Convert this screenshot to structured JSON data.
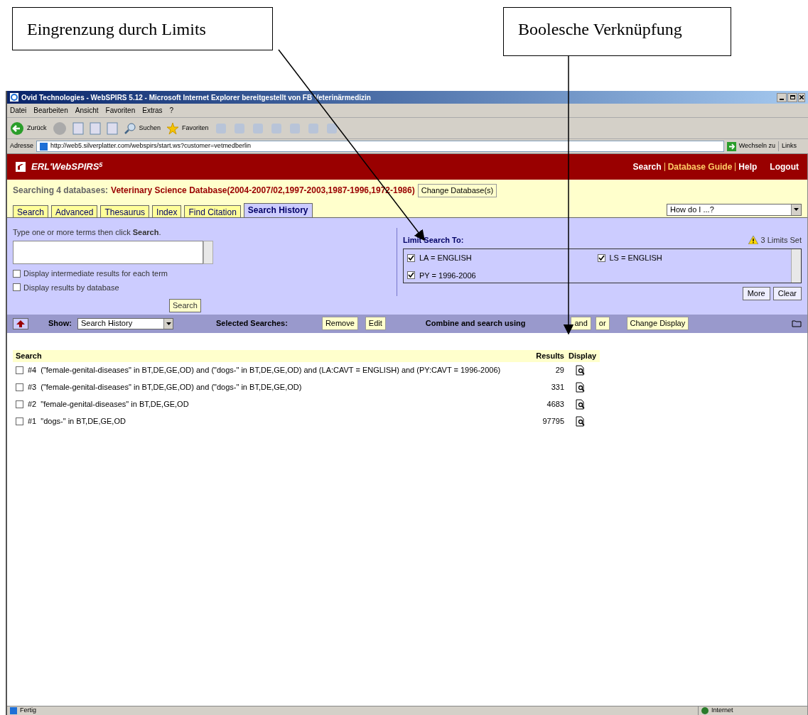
{
  "annotations": [
    {
      "text": "Eingrenzung durch Limits"
    },
    {
      "text": "Boolesche Verknüpfung"
    }
  ],
  "window": {
    "title": "Ovid Technologies - WebSPIRS 5.12 - Microsoft Internet Explorer bereitgestellt von FB Veterinärmedizin"
  },
  "menu": [
    "Datei",
    "Bearbeiten",
    "Ansicht",
    "Favoriten",
    "Extras",
    "?"
  ],
  "toolbar": {
    "back": "Zurück",
    "search": "Suchen",
    "favorites": "Favoriten"
  },
  "address_bar": {
    "label": "Adresse",
    "url": "http://web5.silverplatter.com/webspirs/start.ws?customer=vetmedberlin",
    "go": "Wechseln zu",
    "links": "Links"
  },
  "header": {
    "logo": "ERL'WebSPIRS",
    "logo_version": "5",
    "nav": [
      {
        "label": "Search",
        "selected": true
      },
      {
        "label": "Database Guide",
        "selected": false
      },
      {
        "label": "Help",
        "selected": true
      },
      {
        "label": "Logout",
        "selected": true
      }
    ]
  },
  "databases": {
    "label": "Searching 4 databases:",
    "value": "Veterinary Science Database(2004-2007/02,1997-2003,1987-1996,1972-1986)",
    "button": "Change Database(s)"
  },
  "tabs": [
    {
      "label": "Search",
      "selected": false
    },
    {
      "label": "Advanced",
      "selected": false
    },
    {
      "label": "Thesaurus",
      "selected": false
    },
    {
      "label": "Index",
      "selected": false
    },
    {
      "label": "Find Citation",
      "selected": false
    },
    {
      "label": "Search History",
      "selected": true
    }
  ],
  "help_select": {
    "value": "How do I ...?"
  },
  "search_panel": {
    "prompt": "Type one or more terms then click **Search**.",
    "options": [
      {
        "label": "Display intermediate results for each term",
        "checked": false
      },
      {
        "label": "Display results by database",
        "checked": false
      }
    ],
    "button": "Search"
  },
  "limits": {
    "title": "Limit Search To:",
    "count": "3 Limits Set",
    "items": [
      {
        "label": "LA = ENGLISH",
        "checked": true
      },
      {
        "label": "LS = ENGLISH",
        "checked": true
      },
      {
        "label": "PY = 1996-2006",
        "checked": true
      }
    ],
    "buttons": [
      "More",
      "Clear"
    ]
  },
  "show_bar": {
    "label": "Show:",
    "select": "Search History",
    "selected_label": "Selected Searches:",
    "buttons": [
      "Remove",
      "Edit"
    ],
    "combine_label": "Combine and search using",
    "operators": [
      "and",
      "or"
    ],
    "change_display": "Change Display"
  },
  "history": {
    "columns": [
      "Search",
      "Results",
      "Display"
    ],
    "rows": [
      {
        "checked": false,
        "number": "#4",
        "query": "(\"female-genital-diseases\" in BT,DE,GE,OD) and (\"dogs-\" in BT,DE,GE,OD) and (LA:CAVT = ENGLISH) and (PY:CAVT = 1996-2006)",
        "results": "29"
      },
      {
        "checked": false,
        "number": "#3",
        "query": "(\"female-genital-diseases\" in BT,DE,GE,OD) and (\"dogs-\" in BT,DE,GE,OD)",
        "results": "331"
      },
      {
        "checked": false,
        "number": "#2",
        "query": "\"female-genital-diseases\" in BT,DE,GE,OD",
        "results": "4683"
      },
      {
        "checked": false,
        "number": "#1",
        "query": "\"dogs-\" in BT,DE,GE,OD",
        "results": "97795"
      }
    ]
  },
  "status_bar": {
    "text": "Fertig",
    "zone": "Internet"
  }
}
